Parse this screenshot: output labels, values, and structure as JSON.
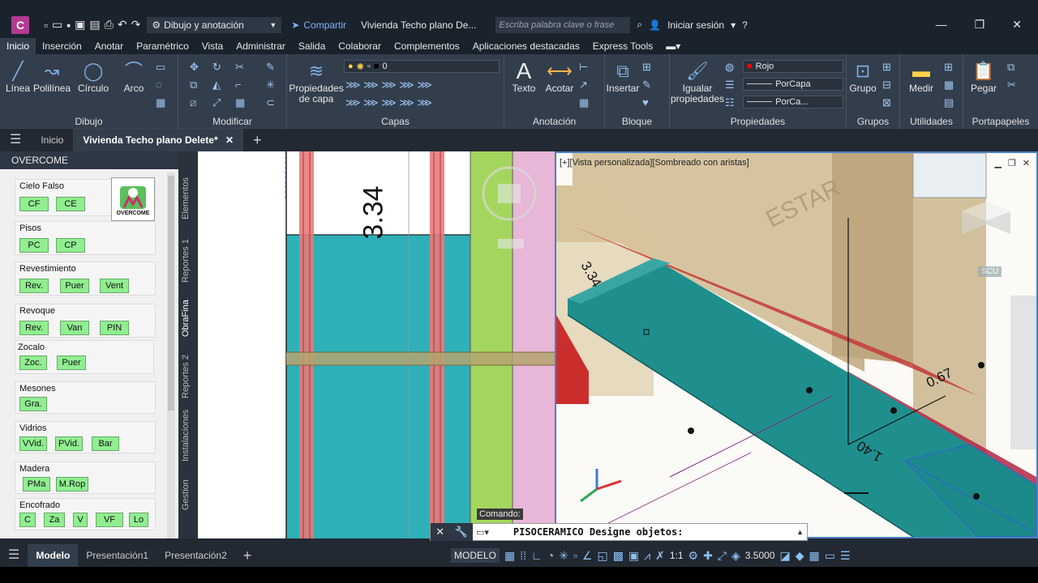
{
  "titlebar": {
    "logo": "C",
    "workspace": "Dibujo y anotación",
    "share": "Compartir",
    "doc_title": "Vivienda Techo plano De...",
    "search_placeholder": "Escriba palabra clave o frase",
    "signin": "Iniciar sesión"
  },
  "menu": [
    "Inicio",
    "Inserción",
    "Anotar",
    "Paramétrico",
    "Vista",
    "Administrar",
    "Salida",
    "Colaborar",
    "Complementos",
    "Aplicaciones destacadas",
    "Express Tools"
  ],
  "ribbon": {
    "dibujo": {
      "title": "Dibujo",
      "linea": "Línea",
      "polilinea": "Polilínea",
      "circulo": "Círculo",
      "arco": "Arco"
    },
    "modificar": {
      "title": "Modificar"
    },
    "capas": {
      "title": "Capas",
      "prop_label": "Propiedades de capa",
      "layer_value": "0"
    },
    "anotacion": {
      "title": "Anotación",
      "texto": "Texto",
      "acotar": "Acotar"
    },
    "bloque": {
      "title": "Bloque",
      "insertar": "Insertar"
    },
    "propiedades": {
      "title": "Propiedades",
      "igualar": "Igualar propiedades",
      "color": "Rojo",
      "linetype": "PorCapa",
      "lineweight": "PorCa..."
    },
    "grupos": {
      "title": "Grupos",
      "grupo": "Grupo"
    },
    "utilidades": {
      "title": "Utilidades",
      "medir": "Medir"
    },
    "portapapeles": {
      "title": "Portapapeles",
      "pegar": "Pegar"
    }
  },
  "filetabs": {
    "home": "Inicio",
    "active": "Vivienda Techo plano Delete*"
  },
  "leftpanel": {
    "title": "OVERCOME",
    "logo_text": "OVERCOME",
    "groups": [
      {
        "title": "Cielo Falso",
        "buttons": [
          "CF",
          "CE"
        ]
      },
      {
        "title": "Pisos",
        "buttons": [
          "PC",
          "CP"
        ]
      },
      {
        "title": "Revestimiento",
        "buttons": [
          "Rev.",
          "Puer",
          "Vent"
        ]
      },
      {
        "title": "Revoque",
        "buttons": [
          "Rev.",
          "Van",
          "PIN"
        ]
      },
      {
        "title": "Zocalo",
        "buttons": [
          "Zoc.",
          "Puer"
        ]
      },
      {
        "title": "Mesones",
        "buttons": [
          "Gra."
        ]
      },
      {
        "title": "Vidrios",
        "buttons": [
          "VVid.",
          "PVid.",
          "Bar"
        ]
      },
      {
        "title": "Madera",
        "buttons": [
          "PMa",
          "M.Rop"
        ]
      },
      {
        "title": "Encofrado",
        "buttons": [
          "C",
          "Za",
          "V",
          "VF",
          "Lo"
        ]
      }
    ],
    "vtabs": [
      "Elementos",
      "Reportes 1",
      "ObraFina",
      "Reportes 2",
      "Instalaciones",
      "Gestion"
    ]
  },
  "canvas2d": {
    "dimension": "3.34"
  },
  "canvas3d": {
    "viewport_label": "[+][Vista personalizada][Sombreado con aristas]",
    "room_label": "ESTAR",
    "dim1": "0.67",
    "dim2": "1.40",
    "dim3": "3.34",
    "ucs": "SCU"
  },
  "command": {
    "label": "Comando:",
    "text": "PISOCERAMICO Designe objetos:"
  },
  "statusbar": {
    "tabs": [
      "Modelo",
      "Presentación1",
      "Presentación2"
    ],
    "model_label": "MODELO",
    "scale": "1:1",
    "value": "3.5000"
  },
  "colors": {
    "accent": "#b33a91",
    "teal": "#2eadb5",
    "cyan": "#2fb8c2",
    "lime": "#a4d65e",
    "pink": "#e8b6d6",
    "red": "#e06060",
    "green_btn": "#90ee90"
  }
}
